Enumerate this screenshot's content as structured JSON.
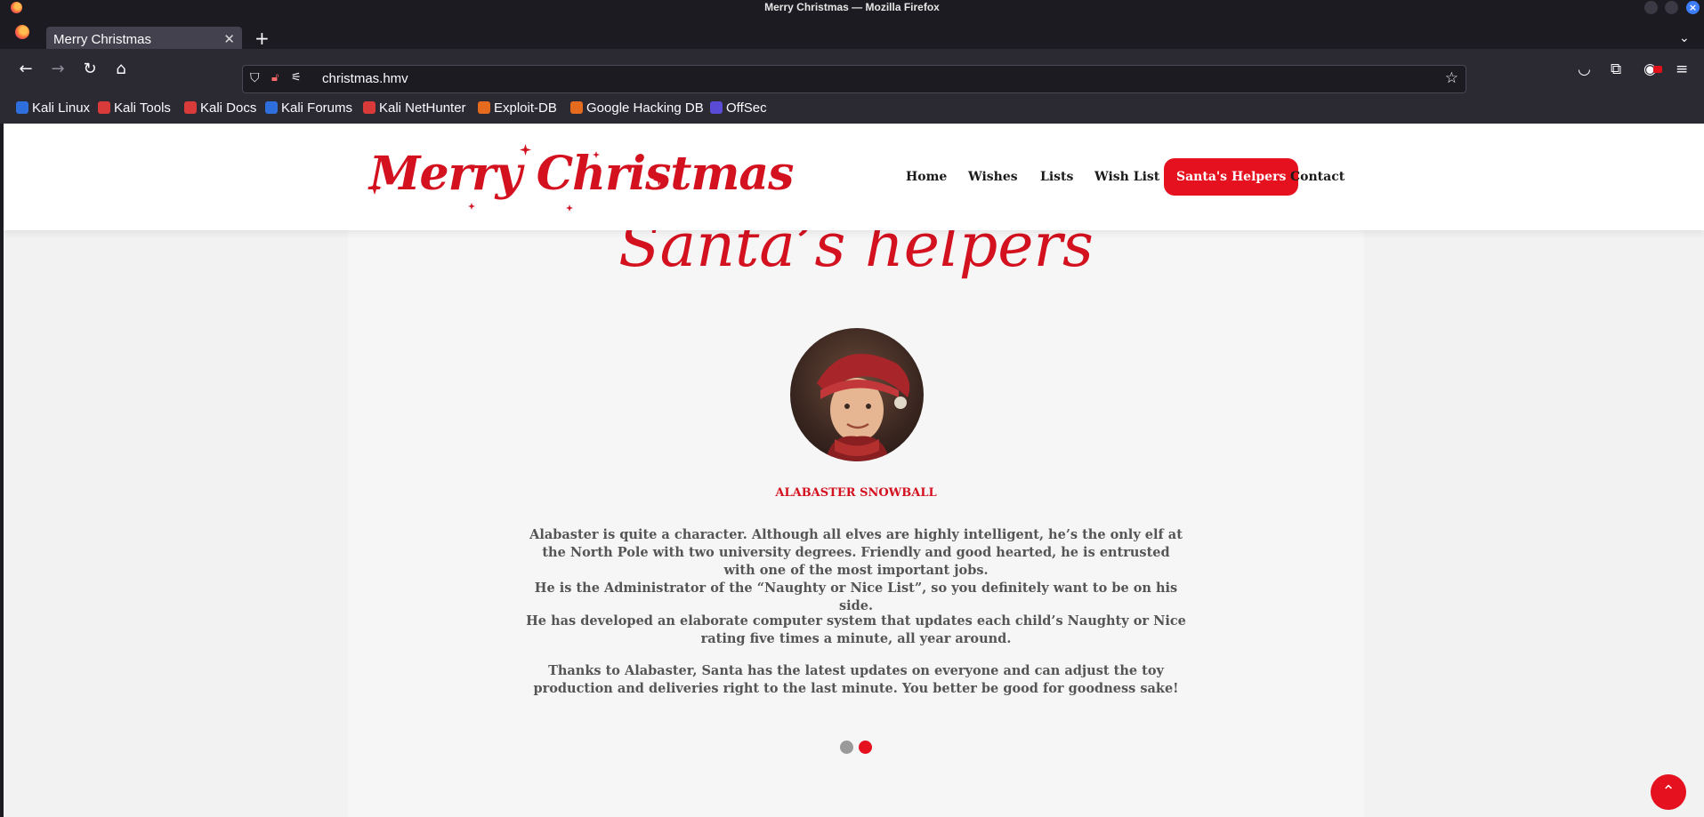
{
  "window": {
    "title": "Merry Christmas — Mozilla Firefox"
  },
  "tabs": [
    {
      "title": "Merry Christmas"
    }
  ],
  "urlbar": {
    "url": "christmas.hmv"
  },
  "bookmarks": [
    {
      "label": "Kali Linux",
      "color": "#2f6fdb"
    },
    {
      "label": "Kali Tools",
      "color": "#d93a3a"
    },
    {
      "label": "Kali Docs",
      "color": "#d93a3a"
    },
    {
      "label": "Kali Forums",
      "color": "#2f6fdb"
    },
    {
      "label": "Kali NetHunter",
      "color": "#d93a3a"
    },
    {
      "label": "Exploit-DB",
      "color": "#e56b1f"
    },
    {
      "label": "Google Hacking DB",
      "color": "#e56b1f"
    },
    {
      "label": "OffSec",
      "color": "#5a4bd6"
    }
  ],
  "site": {
    "logo_text": "Merry Christmas",
    "nav": [
      "Home",
      "Wishes",
      "Lists",
      "Wish List",
      "Santa's Helpers",
      "Contact"
    ],
    "active_nav": "Santa's Helpers",
    "section_title": "Santa’s helpers",
    "helper": {
      "name": "ALABASTER SNOWBALL",
      "paragraphs": [
        "Alabaster is quite a character. Although all elves are highly intelligent, he’s the only elf at the North Pole with two university degrees. Friendly and good hearted, he is entrusted with one of the most important jobs.",
        "He is the Administrator of the “Naughty or Nice List”, so you definitely want to be on his side.",
        "He has developed an elaborate computer system that updates each child’s Naughty or Nice rating five times a minute, all year around.",
        "Thanks to Alabaster, Santa has the latest updates on everyone and can adjust the toy production and deliveries right to the last minute. You better be good for goodness sake!"
      ]
    },
    "carousel": {
      "active_index": 1,
      "count": 2
    },
    "accent_color": "#e5111f"
  }
}
